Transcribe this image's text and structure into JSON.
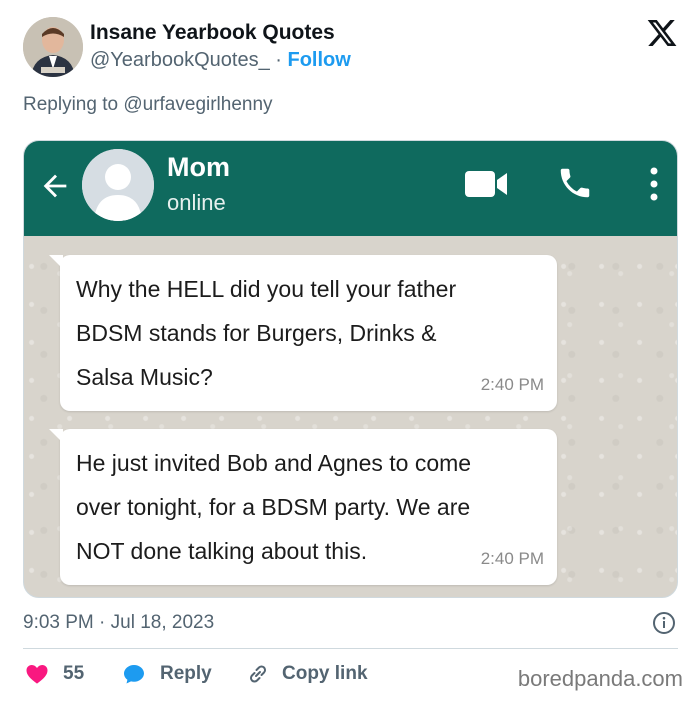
{
  "author": {
    "name": "Insane Yearbook Quotes",
    "handle": "@YearbookQuotes_",
    "separator": "·",
    "follow_label": "Follow"
  },
  "reply_context": {
    "prefix": "Replying to ",
    "mention": "@urfavegirlhenny"
  },
  "chat": {
    "contact_name": "Mom",
    "contact_status": "online",
    "messages": [
      {
        "lines": [
          "Why the HELL did you tell your father",
          "BDSM stands for Burgers, Drinks &",
          "Salsa Music?"
        ],
        "time": "2:40 PM"
      },
      {
        "lines": [
          "He just invited Bob and Agnes to come",
          "over tonight, for a BDSM party. We are",
          "NOT done talking about this."
        ],
        "time": "2:40 PM"
      }
    ],
    "header_color": "#0f6a5e",
    "icons": [
      "back-arrow-icon",
      "video-call-icon",
      "phone-icon",
      "more-vert-icon"
    ]
  },
  "tweet_meta": {
    "timestamp": "9:03 PM · Jul 18, 2023"
  },
  "actions": {
    "like_count": "55",
    "reply_label": "Reply",
    "copy_link_label": "Copy link"
  },
  "watermark": "boredpanda.com",
  "colors": {
    "accent": "#1d9bf0",
    "like": "#f91880",
    "secondary_text": "#536471"
  }
}
